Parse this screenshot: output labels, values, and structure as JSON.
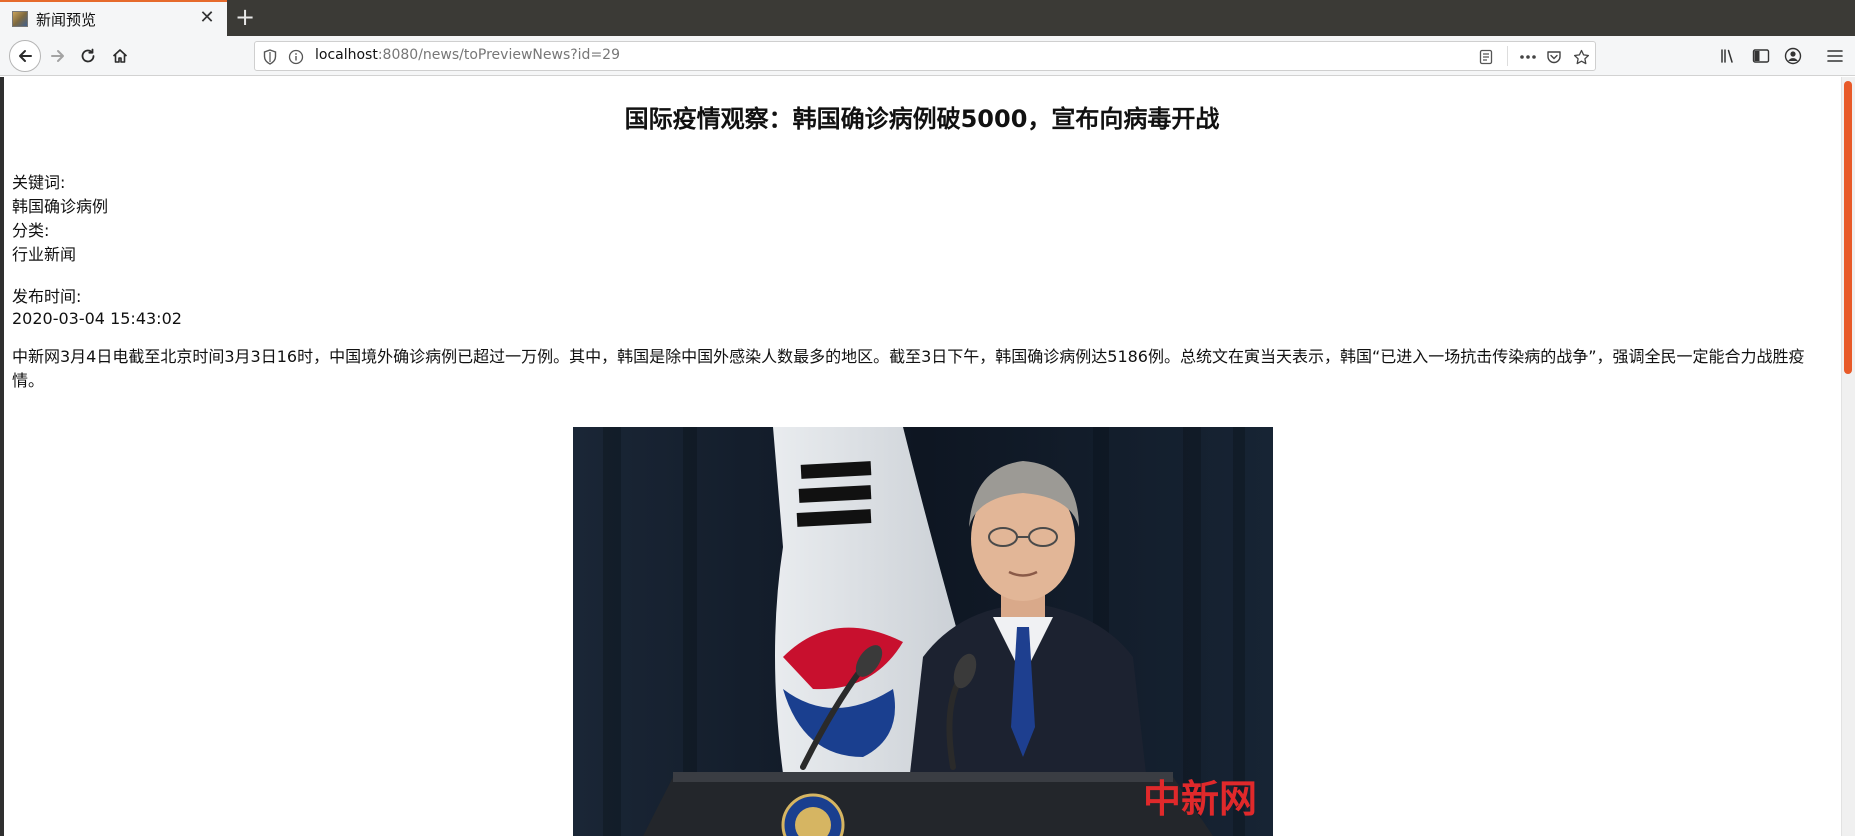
{
  "browser": {
    "tab": {
      "title": "新闻预览",
      "close_glyph": "✕",
      "favicon": "picture-icon"
    },
    "new_tab_glyph": "+",
    "url": {
      "host": "localhost",
      "rest": ":8080/news/toPreviewNews?id=29"
    },
    "icons": [
      "back-arrow-icon",
      "forward-arrow-icon",
      "reload-icon",
      "home-icon",
      "shield-icon",
      "info-icon",
      "reader-view-icon",
      "more-dots-icon",
      "pocket-icon",
      "bookmark-star-icon",
      "library-icon",
      "sidebar-icon",
      "account-icon",
      "hamburger-menu-icon"
    ]
  },
  "news": {
    "title": "国际疫情观察：韩国确诊病例破5000，宣布向病毒开战",
    "keywords_label": "关键词:",
    "keywords": "韩国确诊病例",
    "category_label": "分类:",
    "category": "行业新闻",
    "publish_label": "发布时间:",
    "publish_time": "2020-03-04 15:43:02",
    "body": "中新网3月4日电截至北京时间3月3日16时，中国境外确诊病例已超过一万例。其中，韩国是除中国外感染人数最多的地区。截至3日下午，韩国确诊病例达5186例。总统文在寅当天表示，韩国“已进入一场抗击传染病的战争”，强调全民一定能合力战胜疫情。",
    "photo_watermark": "中新网"
  },
  "colors": {
    "accent": "#e66a2c",
    "scroll_thumb": "#e85a29",
    "tabstrip": "#3b3a36",
    "toolbar": "#f5f6f7"
  }
}
